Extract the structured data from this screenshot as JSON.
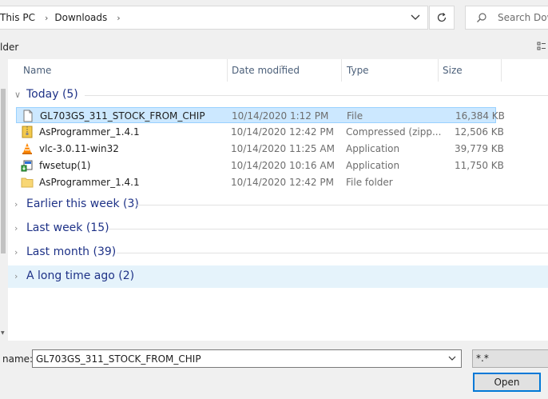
{
  "address": {
    "crumbs": [
      "This PC",
      "Downloads"
    ],
    "search_placeholder": "Search Dow"
  },
  "toolbar": {
    "new_folder": "lder"
  },
  "columns": {
    "name": "Name",
    "date": "Date modified",
    "type": "Type",
    "size": "Size"
  },
  "groups": {
    "today": "Today (5)",
    "earlier": "Earlier this week (3)",
    "last_week": "Last week (15)",
    "last_month": "Last month (39)",
    "long_ago": "A long time ago (2)"
  },
  "files": [
    {
      "name": "GL703GS_311_STOCK_FROM_CHIP",
      "date": "10/14/2020 1:12 PM",
      "type": "File",
      "size": "16,384 KB",
      "icon": "blank-file-icon"
    },
    {
      "name": "AsProgrammer_1.4.1",
      "date": "10/14/2020 12:42 PM",
      "type": "Compressed (zipp...",
      "size": "12,506 KB",
      "icon": "zip-folder-icon"
    },
    {
      "name": "vlc-3.0.11-win32",
      "date": "10/14/2020 11:25 AM",
      "type": "Application",
      "size": "39,779 KB",
      "icon": "vlc-cone-icon"
    },
    {
      "name": "fwsetup(1)",
      "date": "10/14/2020 10:16 AM",
      "type": "Application",
      "size": "11,750 KB",
      "icon": "installer-icon"
    },
    {
      "name": "AsProgrammer_1.4.1",
      "date": "10/14/2020 12:42 PM",
      "type": "File folder",
      "size": "",
      "icon": "folder-icon"
    }
  ],
  "bottom": {
    "name_label": "name:",
    "filename": "GL703GS_311_STOCK_FROM_CHIP",
    "filter": "*.*",
    "open": "Open"
  }
}
